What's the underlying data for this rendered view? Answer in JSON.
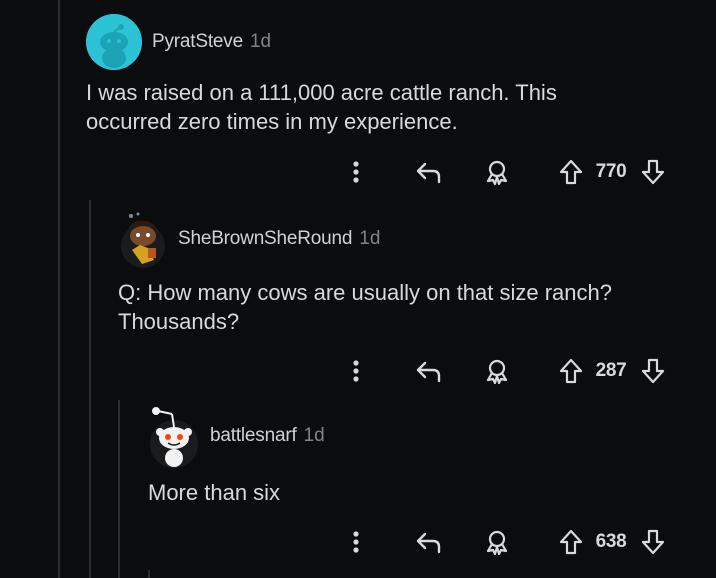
{
  "comments": [
    {
      "username": "PyratSteve",
      "age": "1d",
      "body": "I was raised on a 111,000 acre cattle ranch. This occurred zero times in my experience.",
      "score": "770",
      "avatar_color": "#2cc3d6"
    },
    {
      "username": "SheBrownSheRound",
      "age": "1d",
      "body": "Q: How many cows are usually on that size ranch? Thousands?",
      "score": "287",
      "avatar_color": "#1a1b1d"
    },
    {
      "username": "battlesnarf",
      "age": "1d",
      "body": "More than six",
      "score": "638",
      "avatar_color": "#1a1b1d"
    }
  ],
  "icons": {
    "more": "more-vertical-icon",
    "reply": "reply-icon",
    "award": "award-icon",
    "upvote": "upvote-icon",
    "downvote": "downvote-icon"
  },
  "colors": {
    "background": "#0b0c0e",
    "text": "#d7dadc",
    "muted": "#818384",
    "thread_line": "#2a2c30"
  }
}
